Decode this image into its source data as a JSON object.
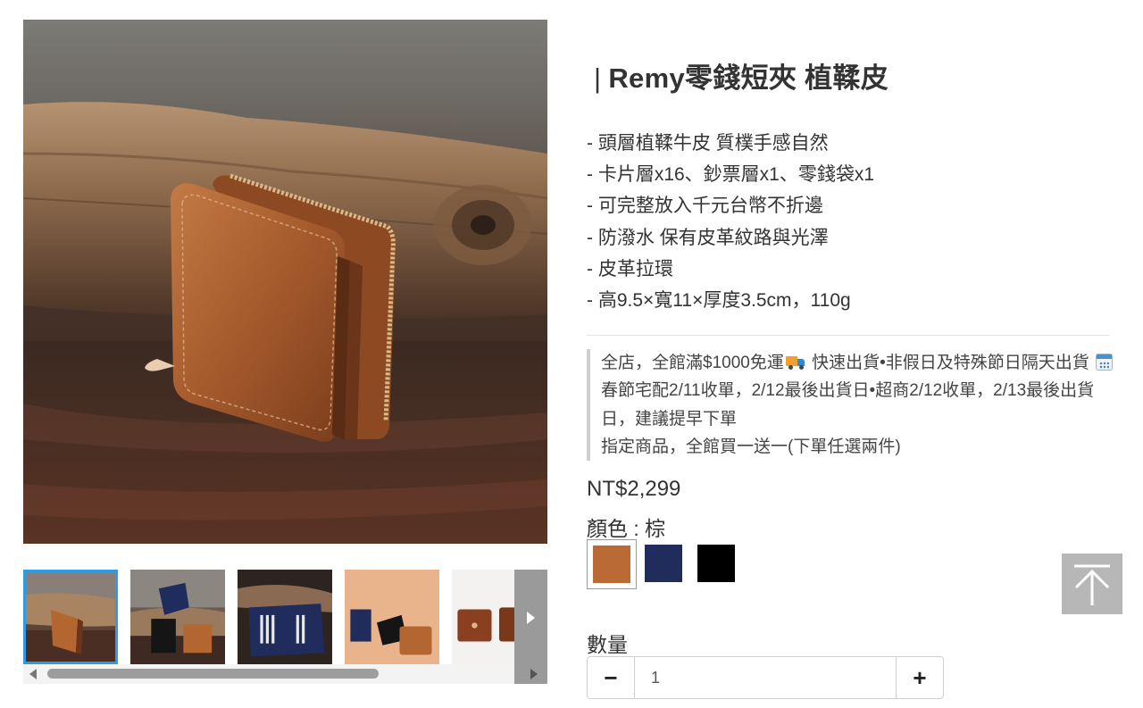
{
  "product": {
    "title_bar": "|",
    "title": "Remy零錢短夾 植鞣皮",
    "features": [
      "- 頭層植鞣牛皮 質樸手感自然",
      "- 卡片層x16、鈔票層x1、零錢袋x1",
      "- 可完整放入千元台幣不折邊",
      "- 防潑水 保有皮革紋路與光澤",
      "- 皮革拉環",
      "- 高9.5×寬11×厚度3.5cm，110g"
    ],
    "price": "NT$2,299",
    "color_label": "顏色 : 棕",
    "swatches": [
      {
        "name": "棕",
        "hex": "#b96a35",
        "selected": true
      },
      {
        "name": "藍",
        "hex": "#1f2c5c",
        "selected": false
      },
      {
        "name": "黑",
        "hex": "#000000",
        "selected": false
      }
    ],
    "quantity_label": "數量",
    "quantity_value": "1",
    "minus_symbol": "−",
    "plus_symbol": "+"
  },
  "promo": {
    "line1_a": "全店，全館滿$1000免運",
    "line1_b": "快速出貨•非假日及特殊節日隔天出貨",
    "line1_c": "春節宅配2/11收單，2/12最後出貨日•超商2/12收單，2/13最後出貨日，建議提早下單",
    "line2": "指定商品，全館買一送一(下單任選兩件)",
    "truck_icon": "truck-icon",
    "calendar_icon": "calendar-icon"
  },
  "gallery": {
    "thumbnail_count_visible": 5,
    "active_index": 0,
    "scroll_position": 0.0
  },
  "colors": {
    "accent": "#2e9be6",
    "back_to_top_bg": "#b7b7b7",
    "text": "#333333"
  }
}
